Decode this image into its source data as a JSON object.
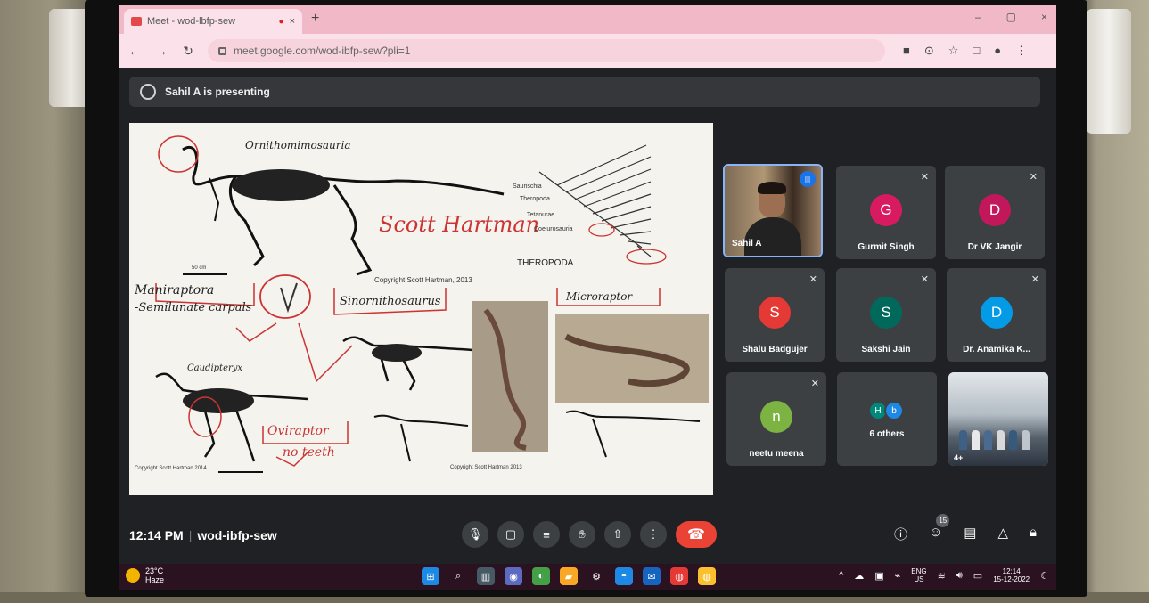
{
  "browser": {
    "tab_title": "Meet - wod-lbfp-sew",
    "tab_close": "×",
    "new_tab": "+",
    "url": "meet.google.com/wod-ibfp-sew?pli=1",
    "win_min": "‒",
    "win_max": "▢",
    "win_close": "×"
  },
  "presenting": {
    "text": "Sahil A is presenting"
  },
  "slide": {
    "title_top": "Ornithomimosauria",
    "signature": "Scott Hartman",
    "copyright_1": "Copyright Scott Hartman, 2013",
    "theropoda": "THEROPODA",
    "maniraptora": "Maniraptora",
    "semilunate": "-Semilunate carpals",
    "ornithosaurus": "Sinornithosaurus",
    "microraptor": "Microraptor",
    "caudipteryx": "Caudipteryx",
    "oviraptor": "Oviraptor",
    "claw_note": "no teeth",
    "small_left": "Copyright Scott Hartman 2014",
    "small_mid": "Copyright Scott Hartman 2013",
    "clade_1": "Saurischia",
    "clade_2": "Theropoda",
    "clade_3": "Tetanurae",
    "clade_4": "Coelurosauria",
    "scale_label": "50 cm"
  },
  "participants": [
    {
      "name": "Sahil A",
      "initial": "",
      "color": "#1a73e8",
      "muted": false,
      "video": true
    },
    {
      "name": "Gurmit Singh",
      "initial": "G",
      "color": "#d81b60",
      "muted": true
    },
    {
      "name": "Dr VK Jangir",
      "initial": "D",
      "color": "#c2185b",
      "muted": true
    },
    {
      "name": "Shalu Badgujer",
      "initial": "S",
      "color": "#e53935",
      "muted": true
    },
    {
      "name": "Sakshi Jain",
      "initial": "S",
      "color": "#00695c",
      "muted": true
    },
    {
      "name": "Dr. Anamika K...",
      "initial": "D",
      "color": "#039be5",
      "muted": true
    },
    {
      "name": "neetu meena",
      "initial": "n",
      "color": "#7cb342",
      "muted": true
    },
    {
      "name": "6 others",
      "initial_a": "H",
      "initial_b": "b",
      "color_a": "#00897b",
      "color_b": "#1e88e5"
    },
    {
      "name": "",
      "video": true,
      "group_count": "4+"
    }
  ],
  "controls": {
    "time": "12:14 PM",
    "meeting_code": "wod-ibfp-sew",
    "people_count": "15"
  },
  "taskbar": {
    "weather_temp": "23°C",
    "weather_desc": "Haze",
    "lang_1": "ENG",
    "lang_2": "US",
    "time": "12:14",
    "date": "15-12-2022"
  },
  "colors": {
    "end_call": "#ea4335",
    "meet_bg": "#202124",
    "tile_bg": "#3c4043",
    "tab_bar": "#f1b8c8"
  }
}
